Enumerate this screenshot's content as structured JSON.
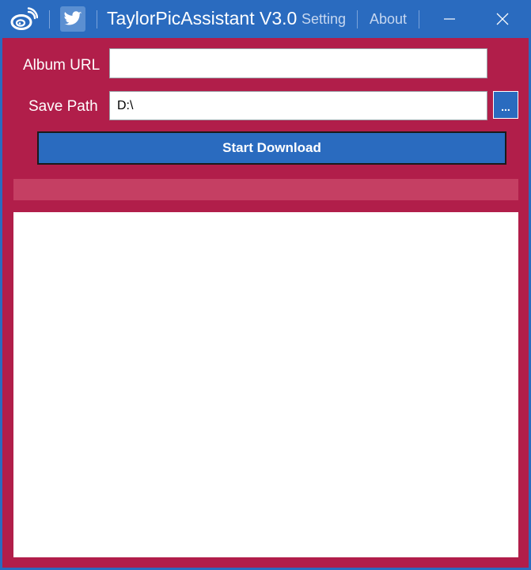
{
  "titlebar": {
    "app_title": "TaylorPicAssistant V3.0",
    "menu": {
      "setting": "Setting",
      "about": "About"
    },
    "icons": {
      "weibo": "weibo-icon",
      "twitter": "twitter-icon",
      "minimize": "minimize-icon",
      "close": "close-icon"
    }
  },
  "form": {
    "album_url_label": "Album URL",
    "album_url_value": "",
    "save_path_label": "Save Path",
    "save_path_value": "D:\\",
    "browse_label": "...",
    "download_button": "Start Download"
  },
  "progress": {
    "fraction": 0
  },
  "log": {
    "text": ""
  },
  "colors": {
    "titlebar_bg": "#2a6bbf",
    "body_bg": "#b11e4a",
    "progress_track": "#c53f63",
    "button_bg": "#2a6bbf"
  }
}
